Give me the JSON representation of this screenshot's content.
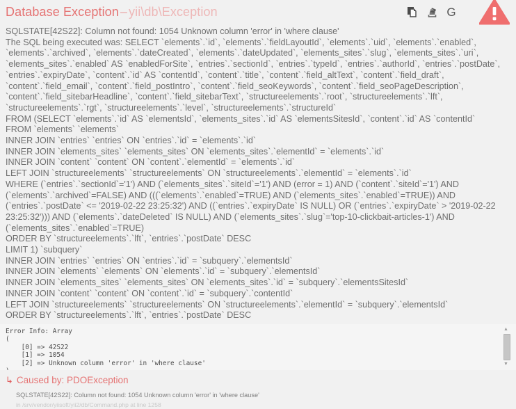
{
  "header": {
    "exception_name": "Database Exception",
    "dash": "–",
    "exception_class": "yii\\db\\Exception",
    "actions": [
      {
        "name": "copy-icon",
        "label": "Copy"
      },
      {
        "name": "stackoverflow-icon",
        "label": "Search on Stack Overflow"
      },
      {
        "name": "google-icon",
        "label": "G"
      }
    ],
    "warning_icon_label": "!",
    "accent_color": "#e57373",
    "muted_accent_color": "#eeb7b7"
  },
  "message": {
    "lines": [
      "SQLSTATE[42S22]: Column not found: 1054 Unknown column 'error' in 'where clause'",
      "The SQL being executed was: SELECT `elements`.`id`, `elements`.`fieldLayoutId`, `elements`.`uid`, `elements`.`enabled`, `elements`.`archived`, `elements`.`dateCreated`, `elements`.`dateUpdated`, `elements_sites`.`slug`, `elements_sites`.`uri`, `elements_sites`.`enabled` AS `enabledForSite`, `entries`.`sectionId`, `entries`.`typeId`, `entries`.`authorId`, `entries`.`postDate`, `entries`.`expiryDate`, `content`.`id` AS `contentId`, `content`.`title`, `content`.`field_altText`, `content`.`field_draft`, `content`.`field_email`, `content`.`field_postIntro`, `content`.`field_seoKeywords`, `content`.`field_seoPageDescription`, `content`.`field_sitebarHeadline`, `content`.`field_sitebarText`, `structureelements`.`root`, `structureelements`.`lft`, `structureelements`.`rgt`, `structureelements`.`level`, `structureelements`.`structureId`",
      "FROM (SELECT `elements`.`id` AS `elementsId`, `elements_sites`.`id` AS `elementsSitesId`, `content`.`id` AS `contentId`",
      "FROM `elements` `elements`",
      "INNER JOIN `entries` `entries` ON `entries`.`id` = `elements`.`id`",
      "INNER JOIN `elements_sites` `elements_sites` ON `elements_sites`.`elementId` = `elements`.`id`",
      "INNER JOIN `content` `content` ON `content`.`elementId` = `elements`.`id`",
      "LEFT JOIN `structureelements` `structureelements` ON `structureelements`.`elementId` = `elements`.`id`",
      "WHERE (`entries`.`sectionId`='1') AND (`elements_sites`.`siteId`='1') AND (error = 1) AND (`content`.`siteId`='1') AND (`elements`.`archived`=FALSE) AND (((`elements`.`enabled`=TRUE) AND (`elements_sites`.`enabled`=TRUE)) AND (`entries`.`postDate` <= '2019-02-22 23:25:32') AND ((`entries`.`expiryDate` IS NULL) OR (`entries`.`expiryDate` > '2019-02-22 23:25:32'))) AND (`elements`.`dateDeleted` IS NULL) AND (`elements_sites`.`slug`='top-10-clickbait-articles-1') AND (`elements_sites`.`enabled`=TRUE)",
      "ORDER BY `structureelements`.`lft`, `entries`.`postDate` DESC",
      "LIMIT 1) `subquery`",
      "INNER JOIN `entries` `entries` ON `entries`.`id` = `subquery`.`elementsId`",
      "INNER JOIN `elements` `elements` ON `elements`.`id` = `subquery`.`elementsId`",
      "INNER JOIN `elements_sites` `elements_sites` ON `elements_sites`.`id` = `subquery`.`elementsSitesId`",
      "INNER JOIN `content` `content` ON `content`.`id` = `subquery`.`contentId`",
      "LEFT JOIN `structureelements` `structureelements` ON `structureelements`.`elementId` = `subquery`.`elementsId`",
      "ORDER BY `structureelements`.`lft`, `entries`.`postDate` DESC"
    ]
  },
  "error_info": {
    "text": "Error Info: Array\n(\n    [0] => 42S22\n    [1] => 1054\n    [2] => Unknown column 'error' in 'where clause'\n)",
    "scroll_up_glyph": "▲",
    "scroll_down_glyph": "▼"
  },
  "previous_exception": {
    "arrow": "↳",
    "title": "Caused by: PDOException",
    "message": "SQLSTATE[42S22]: Column not found: 1054 Unknown column 'error' in 'where clause'",
    "file": "in /srv/vendor/yiisoft/yii2/db/Command.php at line 1258"
  }
}
